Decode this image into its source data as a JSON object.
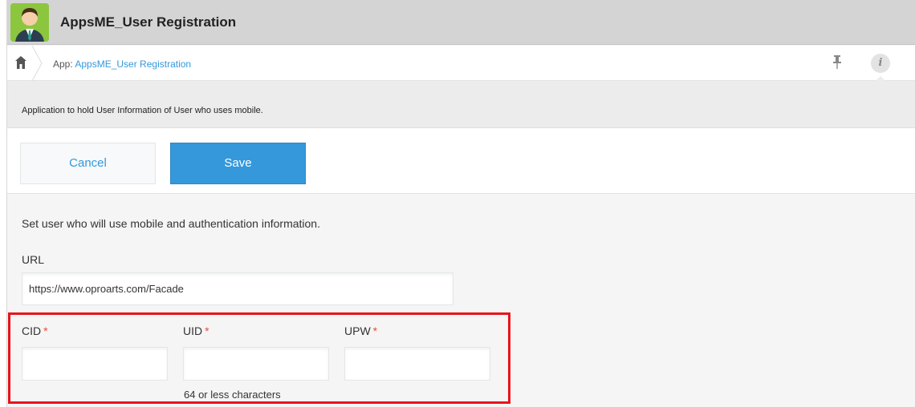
{
  "header": {
    "app_title": "AppsME_User Registration",
    "app_icon": "user-avatar-icon"
  },
  "breadcrumb": {
    "prefix": "App: ",
    "app_link": "AppsME_User Registration"
  },
  "toolbar": {
    "info_label": "i"
  },
  "description": "Application to hold User Information of User who uses mobile.",
  "actions": {
    "cancel_label": "Cancel",
    "save_label": "Save"
  },
  "form": {
    "instruction": "Set user who will use mobile and authentication information.",
    "url": {
      "label": "URL",
      "value": "https://www.oproarts.com/Facade"
    },
    "cid": {
      "label": "CID",
      "required_mark": "*",
      "value": ""
    },
    "uid": {
      "label": "UID",
      "required_mark": "*",
      "value": "",
      "hint": "64 or less characters"
    },
    "upw": {
      "label": "UPW",
      "required_mark": "*",
      "value": ""
    }
  },
  "colors": {
    "accent": "#3498db",
    "required": "#e74c3c",
    "highlight": "#e8141b",
    "app_icon_bg": "#8cc63f"
  }
}
